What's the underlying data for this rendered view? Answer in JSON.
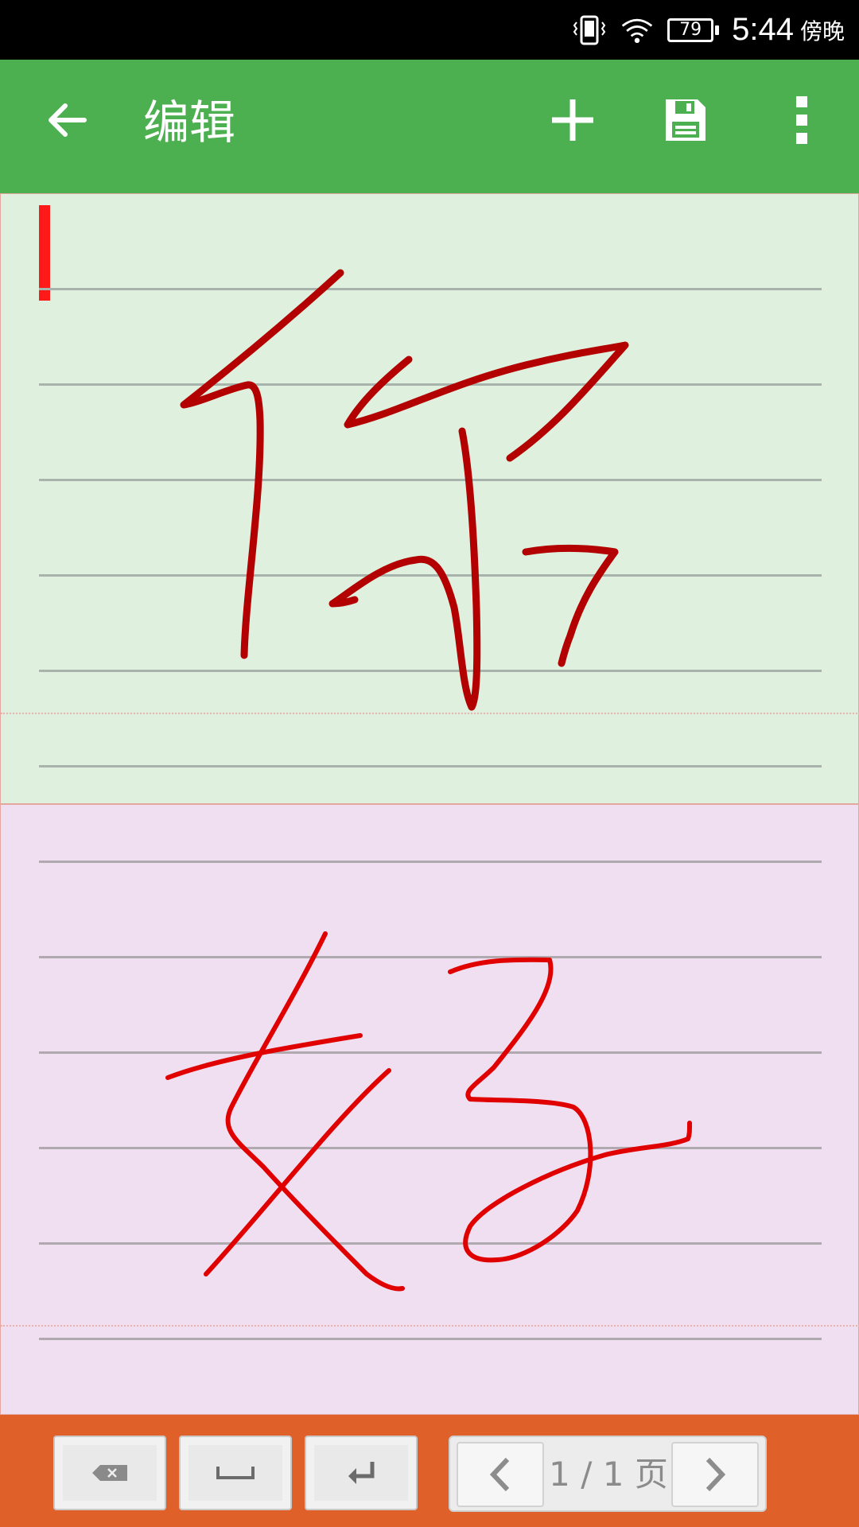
{
  "status_bar": {
    "battery_level": "79",
    "time": "5:44",
    "period": "傍晚"
  },
  "app_bar": {
    "title": "编辑",
    "icons": [
      "back-arrow-icon",
      "plus-icon",
      "save-icon",
      "more-vert-icon"
    ]
  },
  "editor": {
    "top_cell_ink": "#b30000",
    "bottom_cell_ink": "#e00000",
    "cursor_color": "#ff1a1a"
  },
  "toolbar": {
    "page_current": "1",
    "page_separator": "/",
    "page_total": "1",
    "page_unit": "页",
    "icons": [
      "backspace-icon",
      "space-icon",
      "enter-icon",
      "chevron-left-icon",
      "chevron-right-icon"
    ]
  },
  "colors": {
    "app_bar": "#4caf50",
    "toolbar": "#e0602a",
    "top_cell_bg": "#dff0df",
    "bottom_cell_bg": "#efdff0"
  }
}
